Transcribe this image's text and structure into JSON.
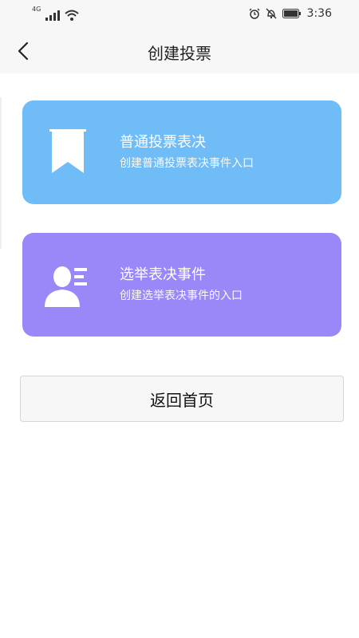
{
  "status_bar": {
    "network": "4G",
    "time": "3:36"
  },
  "nav": {
    "title": "创建投票"
  },
  "cards": [
    {
      "title": "普通投票表决",
      "subtitle": "创建普通投票表决事件入口",
      "icon": "bookmark-icon",
      "color": "#6fbcf7"
    },
    {
      "title": "选举表决事件",
      "subtitle": "创建选举表决事件的入口",
      "icon": "person-list-icon",
      "color": "#9a87f8"
    }
  ],
  "home_button": {
    "label": "返回首页"
  }
}
